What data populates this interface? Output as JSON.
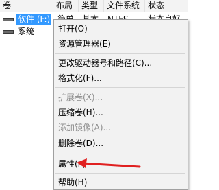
{
  "columns": [
    "卷",
    "布局",
    "类型",
    "文件系统",
    "状态"
  ],
  "volumes": [
    {
      "name": "软件 (F:)",
      "layout": "简单",
      "type": "基本",
      "fs": "NTFS",
      "status": "状态良好"
    },
    {
      "name": "系统",
      "layout": "",
      "type": "",
      "fs": "",
      "status": ""
    }
  ],
  "menu": {
    "items": [
      {
        "label": "打开(O)",
        "enabled": true
      },
      {
        "label": "资源管理器(E)",
        "enabled": true
      },
      {
        "label": "更改驱动器号和路径(C)...",
        "enabled": true
      },
      {
        "label": "格式化(F)...",
        "enabled": true
      },
      {
        "label": "扩展卷(X)...",
        "enabled": false
      },
      {
        "label": "压缩卷(H)...",
        "enabled": true
      },
      {
        "label": "添加镜像(A)...",
        "enabled": false
      },
      {
        "label": "删除卷(D)...",
        "enabled": true
      },
      {
        "label": "属性(P)",
        "enabled": true
      },
      {
        "label": "帮助(H)",
        "enabled": true
      }
    ]
  },
  "annotation": {
    "color": "#e02020"
  }
}
